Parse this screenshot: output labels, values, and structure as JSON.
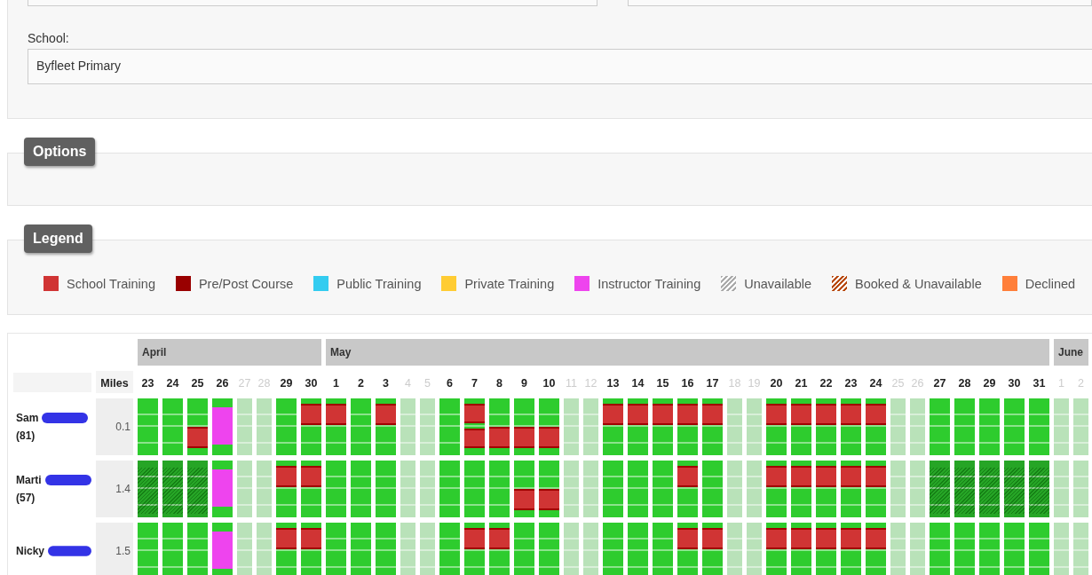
{
  "form": {
    "top_fields": [
      {
        "kind": "input"
      },
      {
        "kind": "input"
      }
    ],
    "school": {
      "label": "School:",
      "value": "Byfleet Primary"
    }
  },
  "options": {
    "title": "Options"
  },
  "legend": {
    "title": "Legend",
    "items": [
      {
        "label": "School Training",
        "color": "#d03434",
        "pattern": false
      },
      {
        "label": "Pre/Post Course",
        "color": "#990000",
        "pattern": false
      },
      {
        "label": "Public Training",
        "color": "#33ccf0",
        "pattern": false
      },
      {
        "label": "Private Training",
        "color": "#ffcc33",
        "pattern": false
      },
      {
        "label": "Instructor Training",
        "color": "#ee44ee",
        "pattern": false
      },
      {
        "label": "Unavailable",
        "color": "#aaaaaa",
        "pattern": true
      },
      {
        "label": "Booked & Unavailable",
        "color": "#b84a10",
        "pattern": true
      },
      {
        "label": "Declined",
        "color": "#ff7f3a",
        "pattern": false
      }
    ]
  },
  "calendar": {
    "miles_heading": "Miles",
    "months": [
      {
        "name": "April",
        "days": [
          {
            "label": "23",
            "weekend": false
          },
          {
            "label": "24",
            "weekend": false
          },
          {
            "label": "25",
            "weekend": false
          },
          {
            "label": "26",
            "weekend": false
          },
          {
            "label": "27",
            "weekend": true
          },
          {
            "label": "28",
            "weekend": true
          },
          {
            "label": "29",
            "weekend": false
          },
          {
            "label": "30",
            "weekend": false
          }
        ]
      },
      {
        "name": "May",
        "days": [
          {
            "label": "1",
            "weekend": false
          },
          {
            "label": "2",
            "weekend": false
          },
          {
            "label": "3",
            "weekend": false
          },
          {
            "label": "4",
            "weekend": true
          },
          {
            "label": "5",
            "weekend": true
          },
          {
            "label": "6",
            "weekend": false
          },
          {
            "label": "7",
            "weekend": false
          },
          {
            "label": "8",
            "weekend": false
          },
          {
            "label": "9",
            "weekend": false
          },
          {
            "label": "10",
            "weekend": false
          },
          {
            "label": "11",
            "weekend": true
          },
          {
            "label": "12",
            "weekend": true
          },
          {
            "label": "13",
            "weekend": false
          },
          {
            "label": "14",
            "weekend": false
          },
          {
            "label": "15",
            "weekend": false
          },
          {
            "label": "16",
            "weekend": false
          },
          {
            "label": "17",
            "weekend": false
          },
          {
            "label": "18",
            "weekend": true
          },
          {
            "label": "19",
            "weekend": true
          },
          {
            "label": "20",
            "weekend": false
          },
          {
            "label": "21",
            "weekend": false
          },
          {
            "label": "22",
            "weekend": false
          },
          {
            "label": "23",
            "weekend": false
          },
          {
            "label": "24",
            "weekend": false
          },
          {
            "label": "25",
            "weekend": true
          },
          {
            "label": "26",
            "weekend": true
          },
          {
            "label": "27",
            "weekend": false
          },
          {
            "label": "28",
            "weekend": false
          },
          {
            "label": "29",
            "weekend": false
          },
          {
            "label": "30",
            "weekend": false
          },
          {
            "label": "31",
            "weekend": false
          }
        ]
      },
      {
        "name": "June",
        "days": [
          {
            "label": "1",
            "weekend": true
          },
          {
            "label": "2",
            "weekend": true
          }
        ]
      }
    ],
    "people": [
      {
        "name": "Sam",
        "count": "(81)",
        "miles": "0.1",
        "cells": [
          {
            "kind": "free"
          },
          {
            "kind": "free"
          },
          {
            "kind": "afternoon"
          },
          {
            "kind": "instructor"
          },
          {
            "kind": "free"
          },
          {
            "kind": "free"
          },
          {
            "kind": "free"
          },
          {
            "kind": "morning"
          },
          {
            "kind": "morning"
          },
          {
            "kind": "free"
          },
          {
            "kind": "morning"
          },
          {
            "kind": "free"
          },
          {
            "kind": "free"
          },
          {
            "kind": "free"
          },
          {
            "kind": "split"
          },
          {
            "kind": "afternoon"
          },
          {
            "kind": "afternoon"
          },
          {
            "kind": "afternoon"
          },
          {
            "kind": "free"
          },
          {
            "kind": "free"
          },
          {
            "kind": "morning"
          },
          {
            "kind": "morning"
          },
          {
            "kind": "morning"
          },
          {
            "kind": "morning"
          },
          {
            "kind": "morning"
          },
          {
            "kind": "free"
          },
          {
            "kind": "free"
          },
          {
            "kind": "morning"
          },
          {
            "kind": "morning"
          },
          {
            "kind": "morning"
          },
          {
            "kind": "morning"
          },
          {
            "kind": "morning"
          },
          {
            "kind": "free"
          },
          {
            "kind": "free"
          },
          {
            "kind": "free"
          },
          {
            "kind": "free"
          },
          {
            "kind": "free"
          },
          {
            "kind": "free"
          },
          {
            "kind": "free"
          },
          {
            "kind": "free"
          },
          {
            "kind": "free"
          }
        ]
      },
      {
        "name": "Marti",
        "count": "(57)",
        "miles": "1.4",
        "cells": [
          {
            "kind": "unavailable"
          },
          {
            "kind": "unavailable"
          },
          {
            "kind": "unavailable"
          },
          {
            "kind": "instructor"
          },
          {
            "kind": "free"
          },
          {
            "kind": "free"
          },
          {
            "kind": "morning"
          },
          {
            "kind": "morning"
          },
          {
            "kind": "free"
          },
          {
            "kind": "free"
          },
          {
            "kind": "free"
          },
          {
            "kind": "free"
          },
          {
            "kind": "free"
          },
          {
            "kind": "free"
          },
          {
            "kind": "free"
          },
          {
            "kind": "free"
          },
          {
            "kind": "afternoon"
          },
          {
            "kind": "afternoon"
          },
          {
            "kind": "free"
          },
          {
            "kind": "free"
          },
          {
            "kind": "free"
          },
          {
            "kind": "free"
          },
          {
            "kind": "free"
          },
          {
            "kind": "morning"
          },
          {
            "kind": "free"
          },
          {
            "kind": "free"
          },
          {
            "kind": "free"
          },
          {
            "kind": "morning"
          },
          {
            "kind": "morning"
          },
          {
            "kind": "morning"
          },
          {
            "kind": "morning"
          },
          {
            "kind": "morning"
          },
          {
            "kind": "free"
          },
          {
            "kind": "free"
          },
          {
            "kind": "unavailable"
          },
          {
            "kind": "unavailable"
          },
          {
            "kind": "unavailable"
          },
          {
            "kind": "unavailable"
          },
          {
            "kind": "unavailable"
          },
          {
            "kind": "free"
          },
          {
            "kind": "free"
          }
        ]
      },
      {
        "name": "Nicky",
        "miles": "1.5",
        "cells": [
          {
            "kind": "free"
          },
          {
            "kind": "free"
          },
          {
            "kind": "free"
          },
          {
            "kind": "instructor"
          },
          {
            "kind": "free"
          },
          {
            "kind": "free"
          },
          {
            "kind": "morning"
          },
          {
            "kind": "morning"
          },
          {
            "kind": "free"
          },
          {
            "kind": "free"
          },
          {
            "kind": "free"
          },
          {
            "kind": "free"
          },
          {
            "kind": "free"
          },
          {
            "kind": "free"
          },
          {
            "kind": "morning"
          },
          {
            "kind": "morning"
          },
          {
            "kind": "free"
          },
          {
            "kind": "free"
          },
          {
            "kind": "free"
          },
          {
            "kind": "free"
          },
          {
            "kind": "free"
          },
          {
            "kind": "free"
          },
          {
            "kind": "free"
          },
          {
            "kind": "morning"
          },
          {
            "kind": "morning"
          },
          {
            "kind": "free"
          },
          {
            "kind": "free"
          },
          {
            "kind": "morning"
          },
          {
            "kind": "morning"
          },
          {
            "kind": "morning"
          },
          {
            "kind": "morning"
          },
          {
            "kind": "morning"
          },
          {
            "kind": "free"
          },
          {
            "kind": "free"
          },
          {
            "kind": "free"
          },
          {
            "kind": "free"
          },
          {
            "kind": "free"
          },
          {
            "kind": "free"
          },
          {
            "kind": "free"
          },
          {
            "kind": "free"
          },
          {
            "kind": "free"
          }
        ]
      }
    ]
  }
}
